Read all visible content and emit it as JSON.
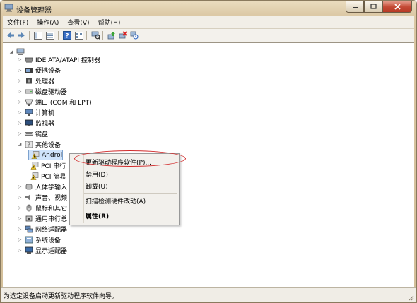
{
  "window": {
    "title": "设备管理器"
  },
  "menubar": {
    "items": [
      "文件(F)",
      "操作(A)",
      "查看(V)",
      "帮助(H)"
    ]
  },
  "tree": {
    "nodes": [
      {
        "label": "IDE ATA/ATAPI 控制器",
        "icon": "ide-controller-icon"
      },
      {
        "label": "便携设备",
        "icon": "portable-device-icon"
      },
      {
        "label": "处理器",
        "icon": "processor-icon"
      },
      {
        "label": "磁盘驱动器",
        "icon": "disk-drive-icon"
      },
      {
        "label": "端口 (COM 和 LPT)",
        "icon": "port-icon"
      },
      {
        "label": "计算机",
        "icon": "computer-icon"
      },
      {
        "label": "监视器",
        "icon": "monitor-icon"
      },
      {
        "label": "键盘",
        "icon": "keyboard-icon"
      },
      {
        "label": "其他设备",
        "icon": "other-devices-icon"
      },
      {
        "label": "Androi",
        "icon": "warning-device-icon"
      },
      {
        "label": "PCI 串行",
        "icon": "warning-device-icon"
      },
      {
        "label": "PCI 简易",
        "icon": "warning-device-icon"
      },
      {
        "label": "人体学输入",
        "icon": "hid-icon"
      },
      {
        "label": "声音、视频",
        "icon": "sound-icon"
      },
      {
        "label": "鼠标和其它",
        "icon": "mouse-icon"
      },
      {
        "label": "通用串行总",
        "icon": "usb-icon"
      },
      {
        "label": "网络适配器",
        "icon": "network-adapter-icon"
      },
      {
        "label": "系统设备",
        "icon": "system-device-icon"
      },
      {
        "label": "显示适配器",
        "icon": "display-adapter-icon"
      }
    ]
  },
  "context_menu": {
    "items": [
      {
        "label": "更新驱动程序软件(P)..."
      },
      {
        "label": "禁用(D)"
      },
      {
        "label": "卸载(U)"
      },
      {
        "label": "扫描检测硬件改动(A)"
      },
      {
        "label": "属性(R)"
      }
    ]
  },
  "status": {
    "text": "为选定设备启动更新驱动程序软件向导。"
  },
  "colors": {
    "highlight_ellipse": "#d12a2a",
    "warning": "#e8c22a"
  }
}
